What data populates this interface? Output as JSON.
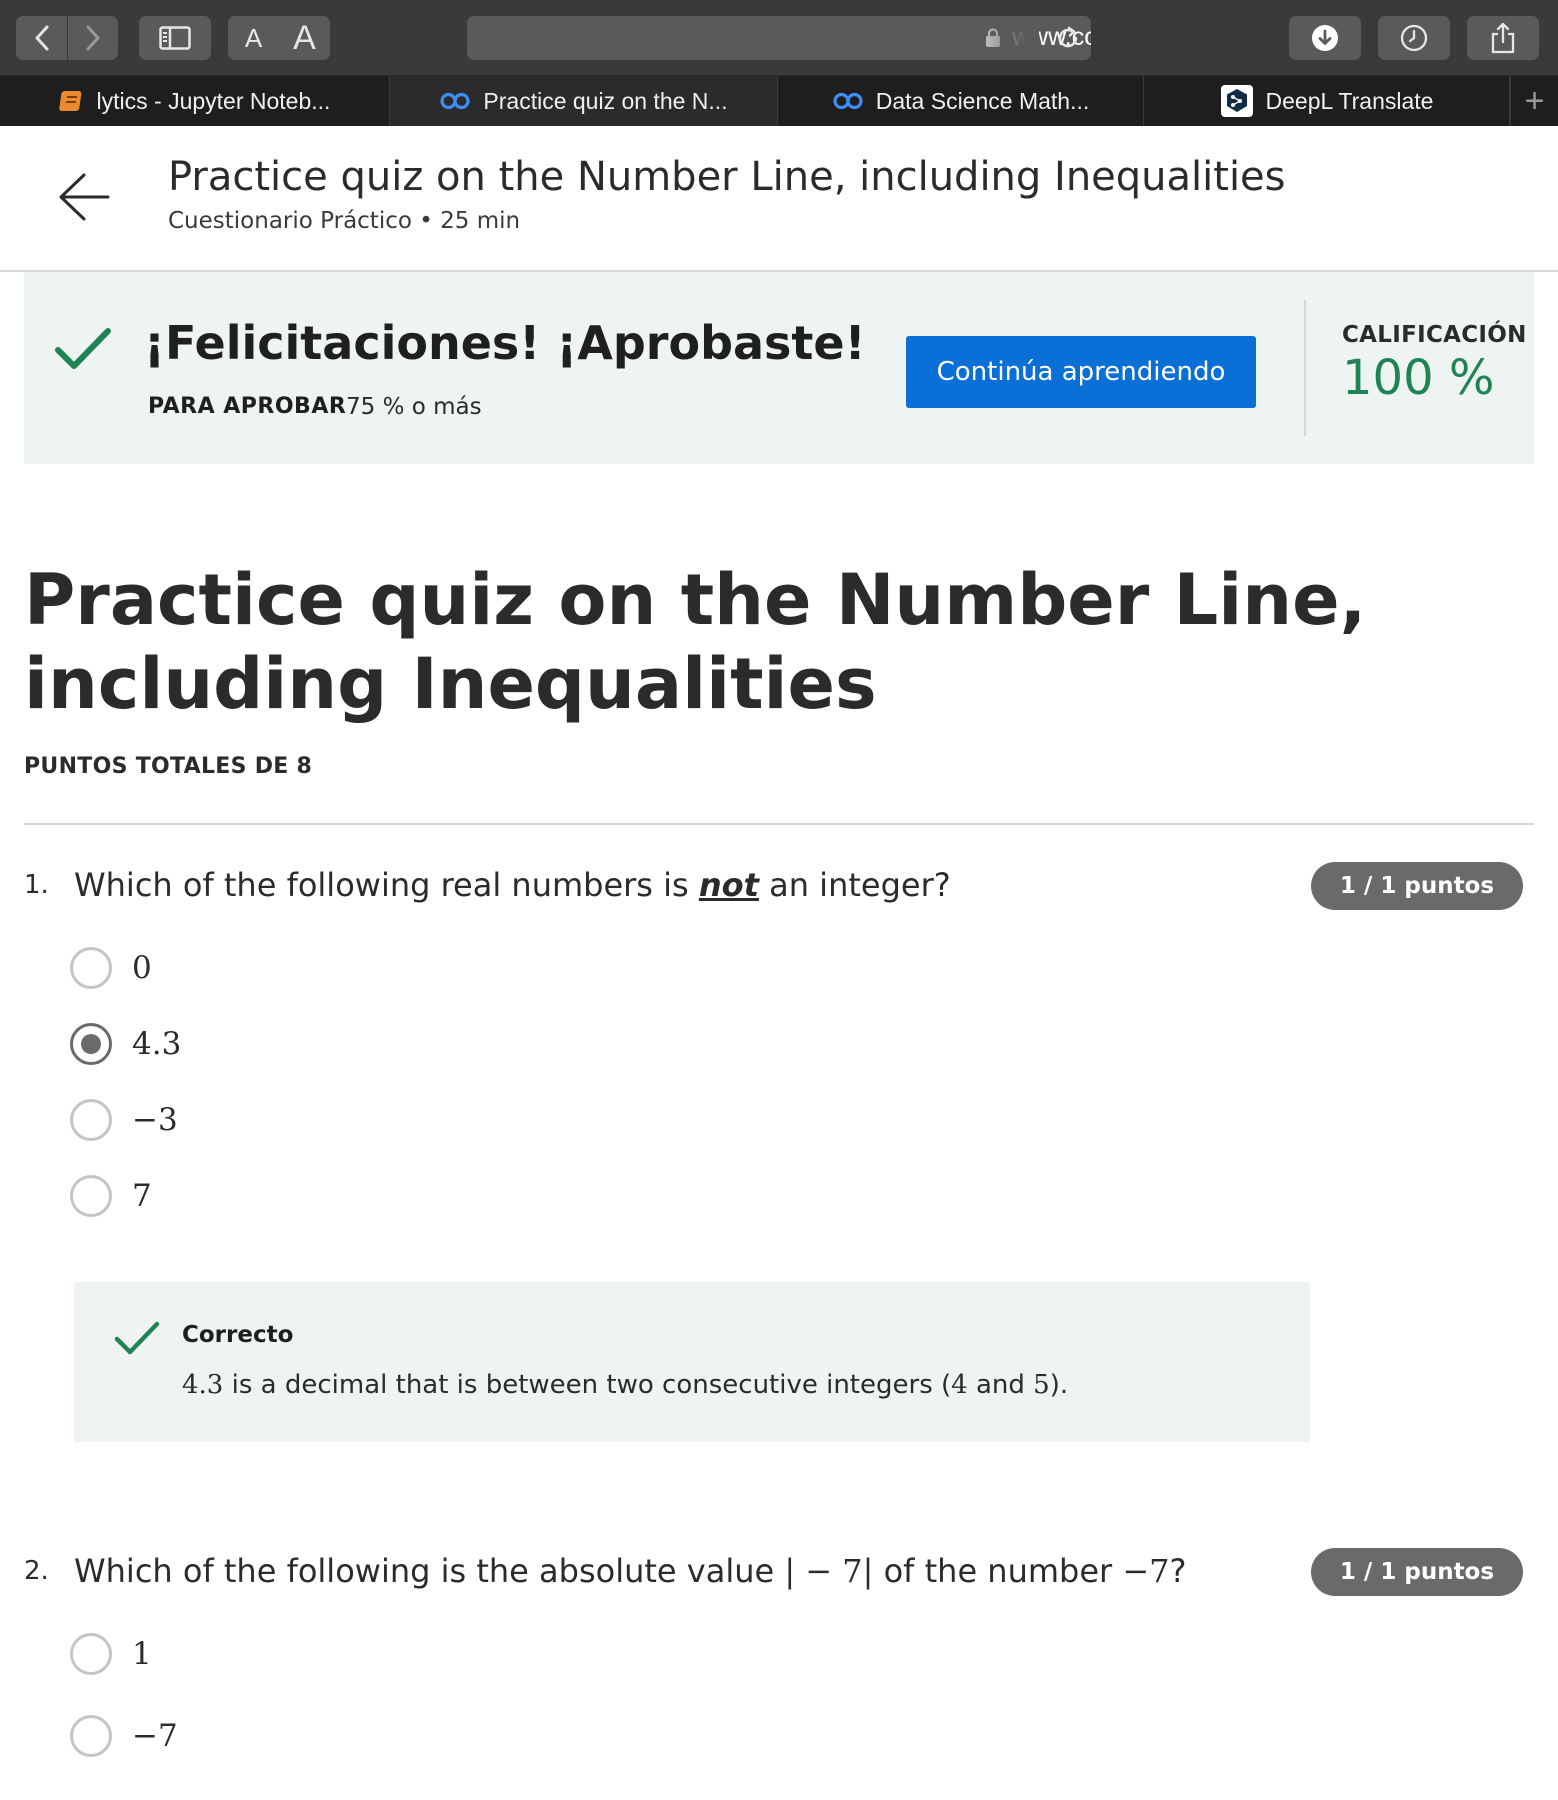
{
  "browser": {
    "url": "www.coursera.org/learn/datasciencemaths",
    "font_small": "A",
    "font_large": "A",
    "tabs": [
      {
        "label": "lytics - Jupyter Noteb...",
        "icon": "jupyter-notebook-icon"
      },
      {
        "label": "Practice quiz on the N...",
        "icon": "coursera-icon",
        "active": true
      },
      {
        "label": "Data Science Math...",
        "icon": "coursera-icon"
      },
      {
        "label": "DeepL Translate",
        "icon": "deepl-icon"
      }
    ],
    "new_tab": "+"
  },
  "header": {
    "title": "Practice quiz on the Number Line, including Inequalities",
    "subtitle": "Cuestionario Práctico • 25 min"
  },
  "result": {
    "message": "¡Felicitaciones! ¡Aprobaste!",
    "pass_label": "PARA APROBAR",
    "pass_value": "75 % o más",
    "button_label": "Continúa aprendiendo",
    "grade_label": "CALIFICACIÓN",
    "grade_value": "100 %"
  },
  "quiz": {
    "title": "Practice quiz on the Number Line, including Inequalities",
    "total_points": "PUNTOS TOTALES DE 8",
    "questions": [
      {
        "number": "1.",
        "text_before": "Which of the following real numbers is ",
        "text_emphasis": "not",
        "text_after": " an integer?",
        "points": "1 / 1 puntos",
        "options": [
          "0",
          "4.3",
          "−3",
          "7"
        ],
        "selected_index": 1,
        "feedback": {
          "title": "Correcto",
          "value": "4.3",
          "text_a": " is a decimal that is between two consecutive integers (",
          "value_a": "4",
          "text_b": " and ",
          "value_b": "5",
          "text_c": ")."
        }
      },
      {
        "number": "2.",
        "text_before": "Which of the following is the absolute value ",
        "math_abs": "| − 7|",
        "text_middle": " of the number ",
        "math_num": "−7",
        "text_after": "?",
        "points": "1 / 1 puntos",
        "options": [
          "1",
          "−7"
        ]
      }
    ]
  },
  "colors": {
    "accent_blue": "#0a6fd6",
    "success_green": "#1f8354",
    "banner_bg": "#eef4f2",
    "pill_gray": "#6a6a6a"
  }
}
